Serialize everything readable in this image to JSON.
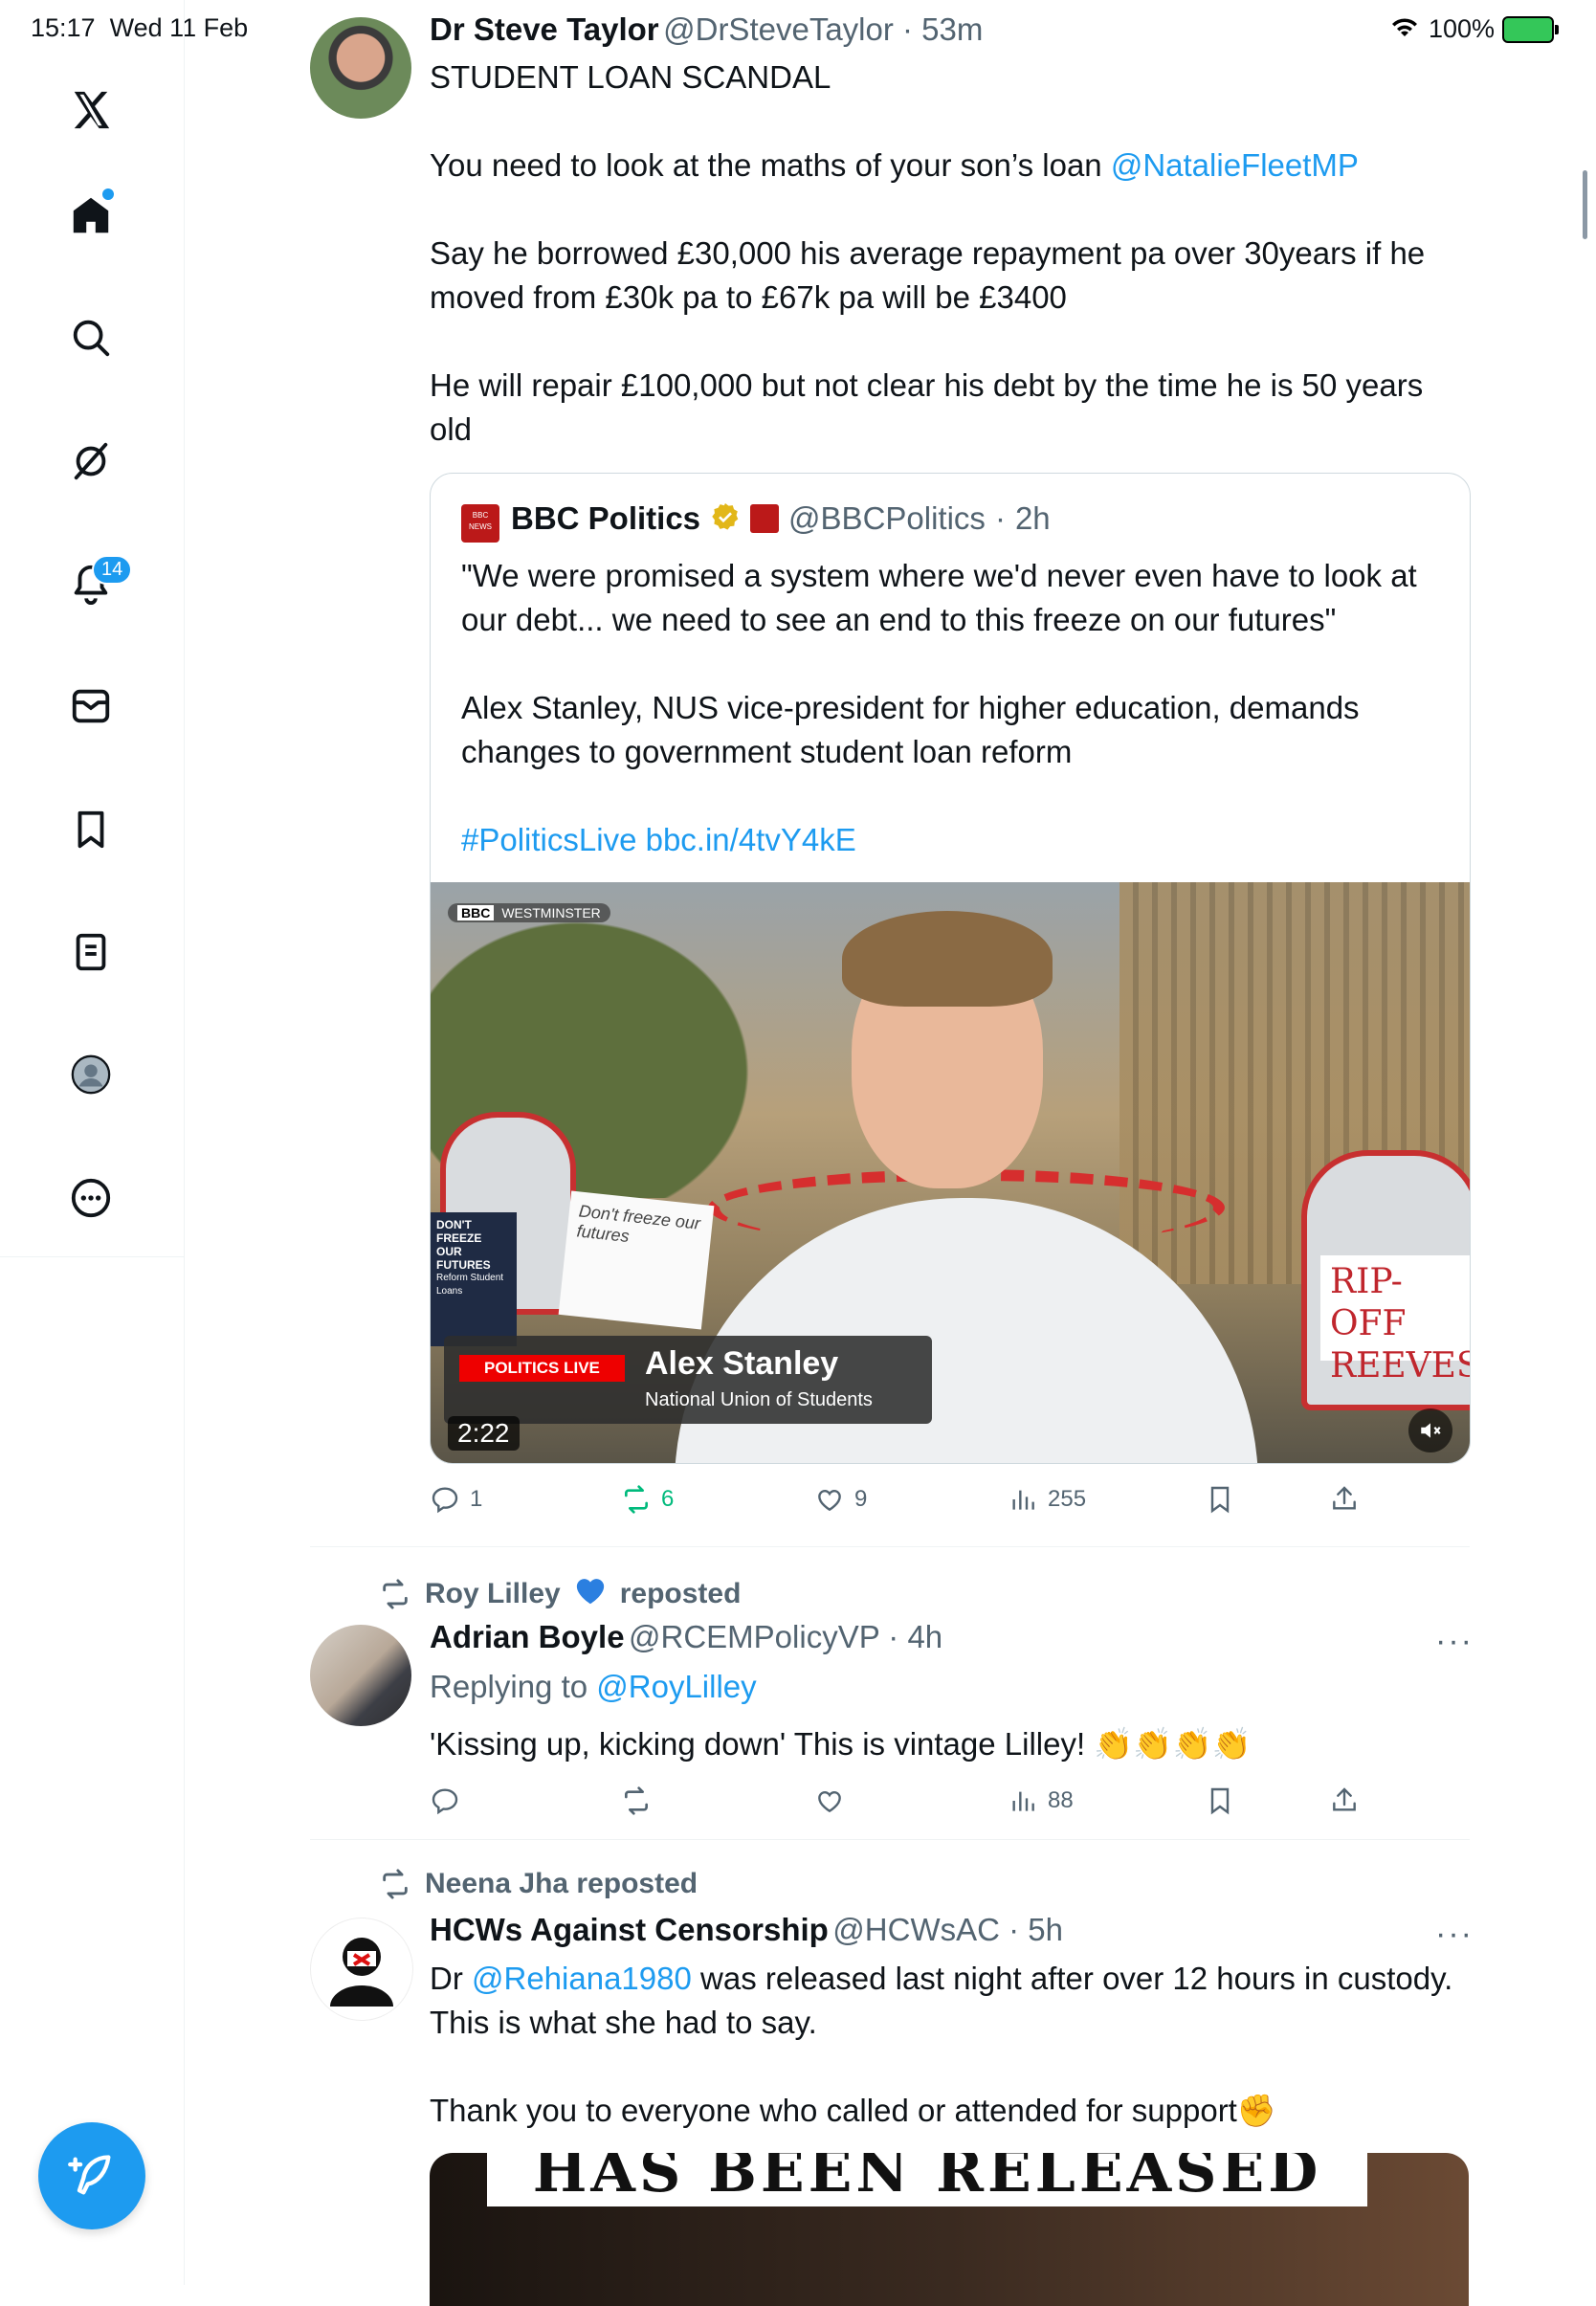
{
  "status_bar": {
    "time": "15:17",
    "date": "Wed 11 Feb",
    "battery": "100%"
  },
  "sidebar": {
    "notifications_badge": "14"
  },
  "tweet1": {
    "name": "Dr Steve Taylor",
    "handle": "@DrSteveTaylor",
    "time": "53m",
    "line1": "STUDENT LOAN SCANDAL",
    "line2_prefix": "You need to look at the maths of your son’s loan ",
    "line2_mention": "@NatalieFleetMP",
    "para3": "Say he borrowed £30,000 his average repayment pa over 30years if he moved from £30k pa to £67k pa will be £3400",
    "para4": "He will repair £100,000 but not clear his debt by the time he is 50 years old",
    "quote": {
      "name": "BBC Politics",
      "handle": "@BBCPolitics",
      "time": "2h",
      "para1": "\"We were promised a system where we'd never even have to look at our debt... we need to see an end to this freeze on our futures\"",
      "para2": "Alex Stanley, NUS vice-president for higher education, demands changes to government student loan reform",
      "hashtag": "#PoliticsLive",
      "url": "bbc.in/4tvY4kE",
      "video": {
        "location_tag": "WESTMINSTER",
        "program": "POLITICS LIVE",
        "speaker": "Alex Stanley",
        "org": "National Union of Students",
        "duration": "2:22",
        "sign_left_1": "DON'T FREEZE",
        "sign_left_2": "OUR FUTURES",
        "sign_left_3": "Reform Student Loans",
        "sign_hand": "Don't freeze our futures",
        "sign_right_1": "RIP-OFF",
        "sign_right_2": "REEVES"
      }
    },
    "replies": "1",
    "reposts": "6",
    "likes": "9",
    "views": "255"
  },
  "tweet2": {
    "repost_by": "Roy Lilley",
    "repost_label": "reposted",
    "name": "Adrian Boyle",
    "handle": "@RCEMPolicyVP",
    "time": "4h",
    "replying_prefix": "Replying to ",
    "replying_to": "@RoyLilley",
    "text": "'Kissing up, kicking down' This is vintage Lilley! 👏👏👏👏",
    "views": "88"
  },
  "tweet3": {
    "repost_by": "Neena Jha",
    "repost_label": "reposted",
    "name": "HCWs Against Censorship",
    "handle": "@HCWsAC",
    "time": "5h",
    "text_prefix": "Dr ",
    "mention": "@Rehiana1980",
    "text_suffix": " was released last night after over 12 hours in custody. This is what she had to say.",
    "para2": "Thank you to everyone who called or attended for support✊",
    "image_text": "HAS BEEN RELEASED"
  },
  "colors": {
    "accent": "#1d9bf0",
    "repost_green": "#00ba7c",
    "secondary": "#536471",
    "bbc_red": "#bb1919"
  }
}
